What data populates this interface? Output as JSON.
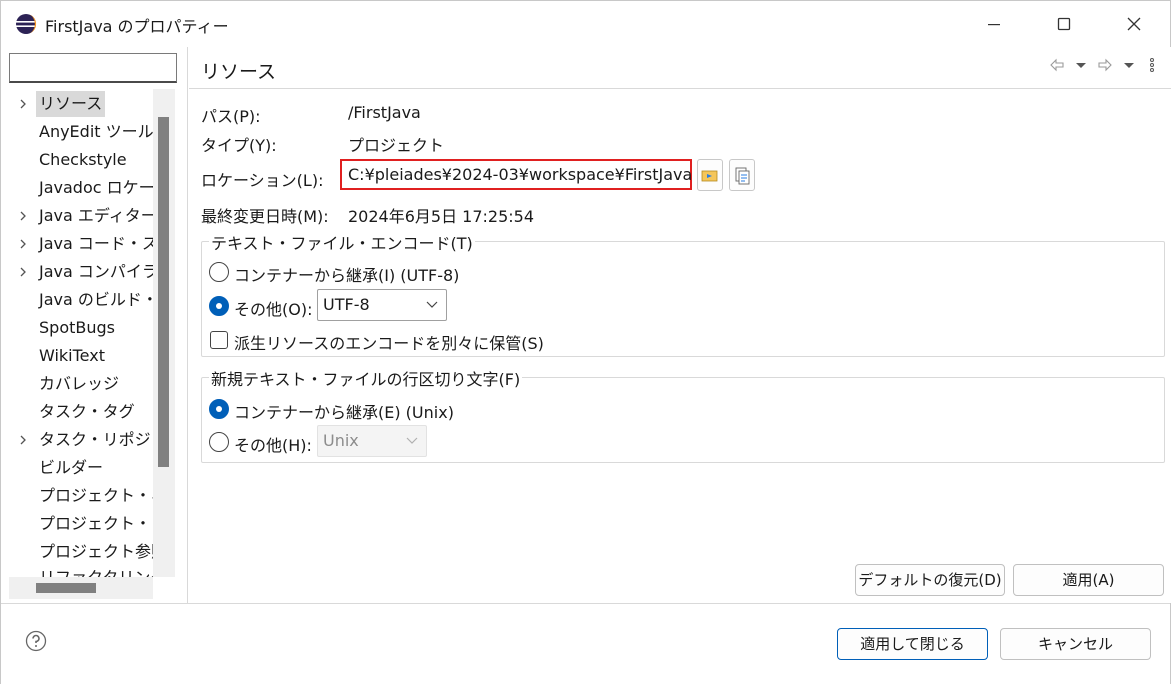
{
  "window": {
    "title": "FirstJava のプロパティー",
    "icons": {
      "app": "eclipse-icon",
      "minimize": "minimize-icon",
      "maximize": "maximize-icon",
      "close": "close-icon"
    }
  },
  "sidebar": {
    "filter_value": "",
    "items": [
      {
        "label": "リソース",
        "expandable": true,
        "selected": true
      },
      {
        "label": "AnyEdit ツール",
        "expandable": false
      },
      {
        "label": "Checkstyle",
        "expandable": false
      },
      {
        "label": "Javadoc ロケーション",
        "expandable": false
      },
      {
        "label": "Java エディター",
        "expandable": true
      },
      {
        "label": "Java コード・スタイル",
        "expandable": true
      },
      {
        "label": "Java コンパイラー",
        "expandable": true
      },
      {
        "label": "Java のビルド・パス",
        "expandable": false
      },
      {
        "label": "SpotBugs",
        "expandable": false
      },
      {
        "label": "WikiText",
        "expandable": false
      },
      {
        "label": "カバレッジ",
        "expandable": false
      },
      {
        "label": "タスク・タグ",
        "expandable": false
      },
      {
        "label": "タスク・リポジトリー",
        "expandable": true
      },
      {
        "label": "ビルダー",
        "expandable": false
      },
      {
        "label": "プロジェクト・ネーチャー",
        "expandable": false
      },
      {
        "label": "プロジェクト・ファセット",
        "expandable": false
      },
      {
        "label": "プロジェクト参照",
        "expandable": false
      },
      {
        "label": "リファクタリング",
        "expandable": false
      }
    ]
  },
  "page": {
    "title": "リソース",
    "nav_icons": [
      "back-arrow-icon",
      "dropdown-icon",
      "forward-arrow-icon",
      "dropdown-icon",
      "view-menu-icon"
    ],
    "path_label": "パス(P):",
    "path_value": "/FirstJava",
    "type_label": "タイプ(Y):",
    "type_value": "プロジェクト",
    "location_label": "ロケーション(L):",
    "location_value": "C:¥pleiades¥2024-03¥workspace¥FirstJava",
    "modified_label": "最終変更日時(M):",
    "modified_value": "2024年6月5日 17:25:54",
    "encoding_group": {
      "title": "テキスト・ファイル・エンコード(T)",
      "inherit_label": "コンテナーから継承(I) (UTF-8)",
      "inherit_checked": false,
      "other_label": "その他(O):",
      "other_checked": true,
      "other_value": "UTF-8",
      "derived_label": "派生リソースのエンコードを別々に保管(S)",
      "derived_checked": false
    },
    "line_delimiter_group": {
      "title": "新規テキスト・ファイルの行区切り文字(F)",
      "inherit_label": "コンテナーから継承(E) (Unix)",
      "inherit_checked": true,
      "other_label": "その他(H):",
      "other_checked": false,
      "other_value": "Unix"
    },
    "restore_defaults_label": "デフォルトの復元(D)",
    "apply_label": "適用(A)"
  },
  "footer": {
    "help_icon": "help-icon",
    "apply_close_label": "適用して閉じる",
    "cancel_label": "キャンセル"
  },
  "colors": {
    "accent": "#005fb8",
    "highlight_border": "#e02020",
    "selection": "#d9d9d9"
  }
}
